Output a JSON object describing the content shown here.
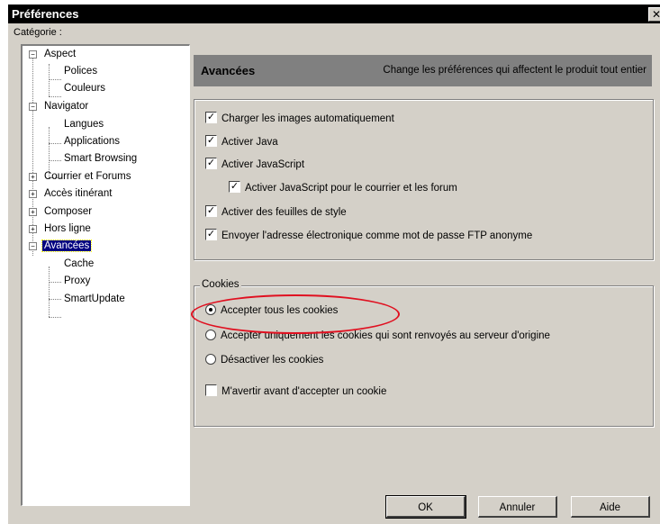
{
  "window": {
    "title": "Préférences",
    "close_glyph": "✕"
  },
  "category_label": "Catégorie :",
  "tree": [
    {
      "label": "Aspect",
      "expander": "−"
    },
    {
      "label": "Polices"
    },
    {
      "label": "Couleurs"
    },
    {
      "label": "Navigator",
      "expander": "−"
    },
    {
      "label": "Langues"
    },
    {
      "label": "Applications"
    },
    {
      "label": "Smart Browsing"
    },
    {
      "label": "Courrier et Forums",
      "expander": "+"
    },
    {
      "label": "Accès itinérant",
      "expander": "+"
    },
    {
      "label": "Composer",
      "expander": "+"
    },
    {
      "label": "Hors ligne",
      "expander": "+"
    },
    {
      "label": "Avancées",
      "expander": "−",
      "selected": true
    },
    {
      "label": "Cache"
    },
    {
      "label": "Proxy"
    },
    {
      "label": "SmartUpdate"
    }
  ],
  "header": {
    "title": "Avancées",
    "description": "Change les préférences qui affectent le produit tout entier"
  },
  "options": [
    {
      "label": "Charger les images automatiquement",
      "checked": true
    },
    {
      "label": "Activer Java",
      "checked": true
    },
    {
      "label": "Activer JavaScript",
      "checked": true
    },
    {
      "label": "Activer JavaScript pour le courrier et les forum",
      "checked": true
    },
    {
      "label": "Activer des feuilles de style",
      "checked": true
    },
    {
      "label": "Envoyer l'adresse électronique comme mot de passe FTP anonyme",
      "checked": true
    }
  ],
  "cookies": {
    "legend": "Cookies",
    "radios": [
      {
        "label": "Accepter tous les cookies",
        "selected": true
      },
      {
        "label": "Accepter uniquement les cookies qui sont renvoyés au serveur d'origine",
        "selected": false
      },
      {
        "label": "Désactiver les cookies",
        "selected": false
      }
    ],
    "warn": {
      "label": "M'avertir avant d'accepter un cookie",
      "checked": false
    }
  },
  "buttons": {
    "ok": "OK",
    "cancel": "Annuler",
    "help": "Aide"
  },
  "colors": {
    "selection": "#000080",
    "highlight_ellipse": "#e01020",
    "dialog_bg": "#d4d0c8",
    "header_bg": "#808080"
  },
  "check_glyph": "✓"
}
